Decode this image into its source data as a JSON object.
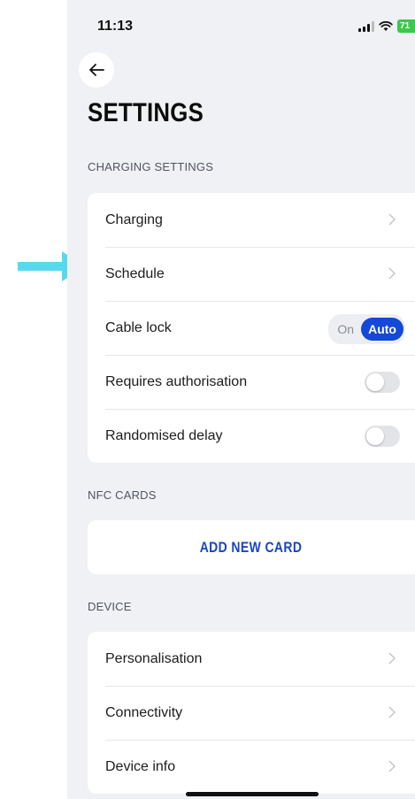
{
  "status_bar": {
    "time": "11:13",
    "battery": "71"
  },
  "page": {
    "title": "SETTINGS"
  },
  "sections": {
    "charging": {
      "header": "CHARGING SETTINGS",
      "items": [
        {
          "label": "Charging",
          "control": "chevron"
        },
        {
          "label": "Schedule",
          "control": "chevron"
        },
        {
          "label": "Cable lock",
          "control": "segmented",
          "options": [
            "On",
            "Auto"
          ],
          "selected": "Auto"
        },
        {
          "label": "Requires authorisation",
          "control": "toggle",
          "value": false
        },
        {
          "label": "Randomised delay",
          "control": "toggle",
          "value": false
        }
      ]
    },
    "nfc": {
      "header": "NFC CARDS",
      "add_button": "ADD NEW CARD"
    },
    "device": {
      "header": "DEVICE",
      "items": [
        {
          "label": "Personalisation",
          "control": "chevron"
        },
        {
          "label": "Connectivity",
          "control": "chevron"
        },
        {
          "label": "Device info",
          "control": "chevron"
        }
      ]
    }
  },
  "colors": {
    "accent": "#1448d8",
    "background": "#f0f1f4",
    "annotation_arrow": "#5ad8ee",
    "battery": "#3cc84a"
  },
  "icons": {
    "back": "arrow-left-icon",
    "chevron": "chevron-right-icon",
    "annotation": "arrow-right-icon"
  }
}
